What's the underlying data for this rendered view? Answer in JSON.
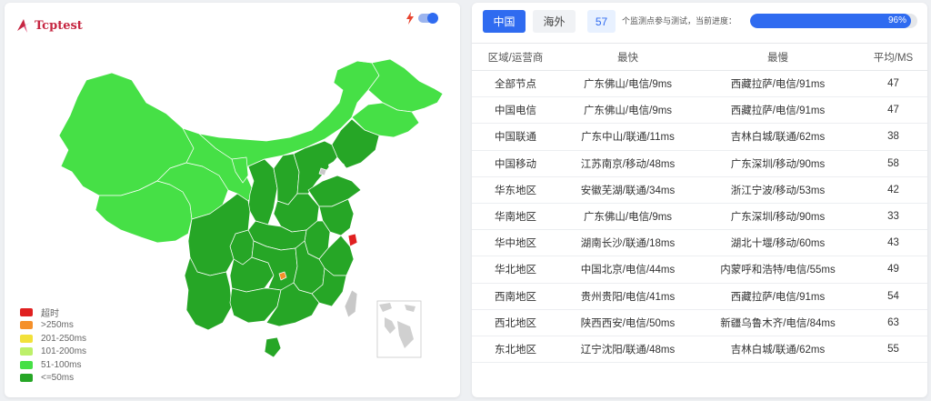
{
  "logo": {
    "text": "Tcptest"
  },
  "tabs": {
    "china": "中国",
    "overseas": "海外"
  },
  "stats": {
    "count": "57",
    "label": "个监测点参与测试，当前进度：",
    "progress_text": "96%",
    "progress": 96
  },
  "legend": [
    {
      "label": "超时",
      "color": "#e02020"
    },
    {
      "label": ">250ms",
      "color": "#f5902a"
    },
    {
      "label": "201-250ms",
      "color": "#f2e13a"
    },
    {
      "label": "101-200ms",
      "color": "#bdf069"
    },
    {
      "label": "51-100ms",
      "color": "#46e046"
    },
    {
      "label": "<=50ms",
      "color": "#26a626"
    }
  ],
  "table": {
    "headers": [
      "区域/运营商",
      "最快",
      "最慢",
      "平均/MS"
    ],
    "rows": [
      [
        "全部节点",
        "广东佛山/电信/9ms",
        "西藏拉萨/电信/91ms",
        "47"
      ],
      [
        "中国电信",
        "广东佛山/电信/9ms",
        "西藏拉萨/电信/91ms",
        "47"
      ],
      [
        "中国联通",
        "广东中山/联通/11ms",
        "吉林白城/联通/62ms",
        "38"
      ],
      [
        "中国移动",
        "江苏南京/移动/48ms",
        "广东深圳/移动/90ms",
        "58"
      ],
      [
        "华东地区",
        "安徽芜湖/联通/34ms",
        "浙江宁波/移动/53ms",
        "42"
      ],
      [
        "华南地区",
        "广东佛山/电信/9ms",
        "广东深圳/移动/90ms",
        "33"
      ],
      [
        "华中地区",
        "湖南长沙/联通/18ms",
        "湖北十堰/移动/60ms",
        "43"
      ],
      [
        "华北地区",
        "中国北京/电信/44ms",
        "内蒙呼和浩特/电信/55ms",
        "49"
      ],
      [
        "西南地区",
        "贵州贵阳/电信/41ms",
        "西藏拉萨/电信/91ms",
        "54"
      ],
      [
        "西北地区",
        "陕西西安/电信/50ms",
        "新疆乌鲁木齐/电信/84ms",
        "63"
      ],
      [
        "东北地区",
        "辽宁沈阳/联通/48ms",
        "吉林白城/联通/62ms",
        "55"
      ]
    ]
  },
  "map_colors": {
    "light": "#46e046",
    "dark": "#26a626",
    "timeout": "#e02020",
    "orange": "#f5902a",
    "grey": "#c8c8c8"
  }
}
